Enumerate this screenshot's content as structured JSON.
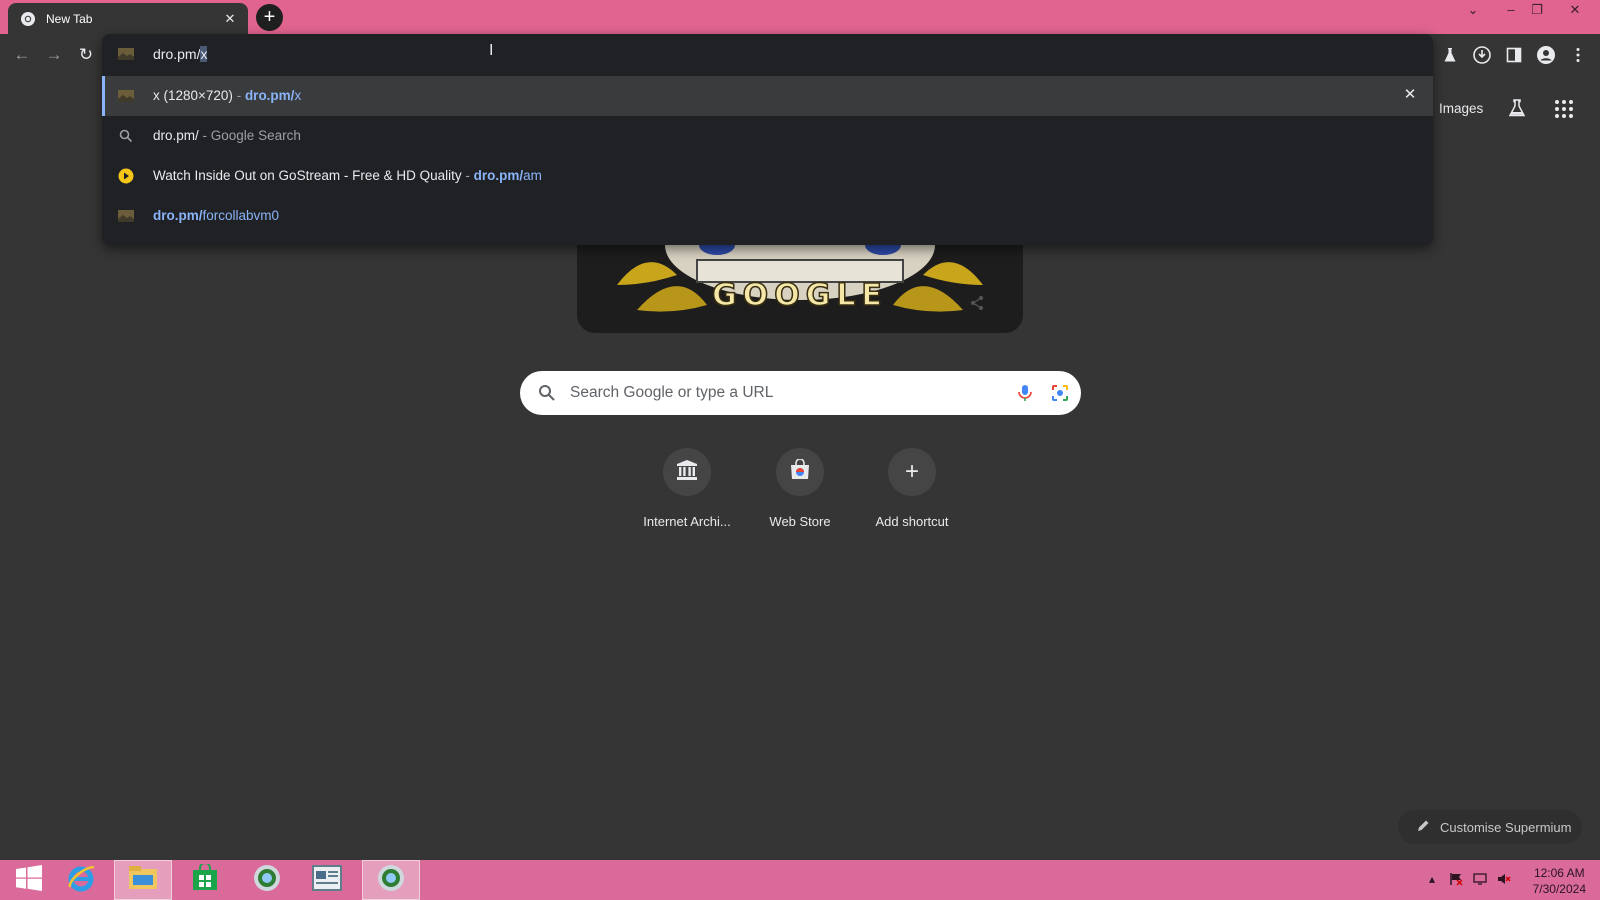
{
  "browser": {
    "tab": {
      "title": "New Tab"
    },
    "new_tab_symbol": "+"
  },
  "omnibox": {
    "typed_text": "dro.pm/",
    "selected_text": "x",
    "suggestions": [
      {
        "title": "x (1280×720)",
        "separator": " - ",
        "url_bold": "dro.pm/",
        "url_rest": "x",
        "icon": "image-icon",
        "selected": true
      },
      {
        "title": "dro.pm/",
        "separator": " - ",
        "desc": "Google Search",
        "icon": "search-icon"
      },
      {
        "title": "Watch Inside Out on GoStream - Free & HD Quality",
        "separator": " - ",
        "url_bold": "dro.pm/",
        "url_rest": "am",
        "icon": "play-icon"
      },
      {
        "url_bold": "dro.pm/",
        "url_rest": "forcollabvm0",
        "icon": "image-icon"
      }
    ]
  },
  "ntp": {
    "images_link": "Images",
    "doodle_text": "GOOGLE",
    "search": {
      "placeholder": "Search Google or type a URL"
    },
    "shortcuts": [
      {
        "label": "Internet Archi...",
        "icon": "archive-icon"
      },
      {
        "label": "Web Store",
        "icon": "web-store-icon"
      },
      {
        "label": "Add shortcut",
        "icon": "plus-icon"
      }
    ],
    "customise_label": "Customise Supermium"
  },
  "taskbar": {
    "time": "12:06 AM",
    "date": "7/30/2024"
  },
  "colors": {
    "accent": "#8ab4f8",
    "tabstrip": "#e0648f",
    "taskbar": "#d96a9a"
  }
}
